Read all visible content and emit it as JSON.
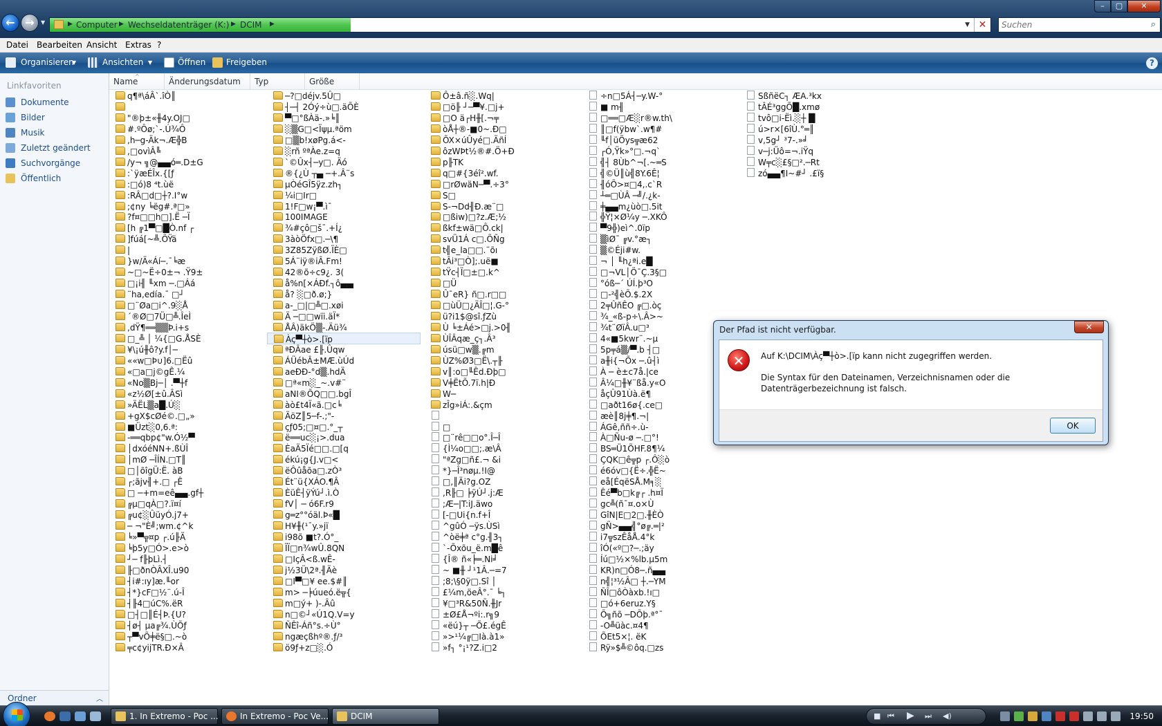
{
  "window": {
    "address": {
      "crumbs": [
        "Computer",
        "Wechseldatenträger (K:)",
        "DCIM"
      ],
      "progress_percent": 32
    },
    "search": {
      "placeholder": "Suchen"
    }
  },
  "menu": [
    "Datei",
    "Bearbeiten",
    "Ansicht",
    "Extras",
    "?"
  ],
  "toolbar": {
    "organize": "Organisieren",
    "views": "Ansichten",
    "open": "Öffnen",
    "share": "Freigeben"
  },
  "sidebar": {
    "title": "Linkfavoriten",
    "items": [
      "Dokumente",
      "Bilder",
      "Musik",
      "Zuletzt geändert",
      "Suchvorgänge",
      "Öffentlich"
    ],
    "folders": "Ordner"
  },
  "columns": [
    "Name",
    "Änderungsdatum",
    "Typ",
    "Größe"
  ],
  "files": [
    [
      {
        "t": "f",
        "n": "q¶ª\\áÂ`.îÒ║"
      },
      {
        "t": "f",
        "n": ""
      },
      {
        "t": "f",
        "n": "\"®þ±«╫4y.OJ□"
      },
      {
        "t": "f",
        "n": "#.ºÔø;`-.Ú¾Ô"
      },
      {
        "t": "f",
        "n": ",h─g-Äk¬.Æ╬B"
      },
      {
        "t": "f",
        "n": ",□ovìÂ╚"
      },
      {
        "t": "f",
        "n": "/y¬ ╗@▄▄ó═.D±G"
      },
      {
        "t": "f",
        "n": ":`ÿæÉÎx.{[ƒ"
      },
      {
        "t": "f",
        "n": ":□ó)8 ⁴t.ùë"
      },
      {
        "t": "f",
        "n": ":RÂ□d□┼?.I°w"
      },
      {
        "t": "f",
        "n": ";¢ny ╘ëg#.ª□»"
      },
      {
        "t": "f",
        "n": "?f¤□□h□].Ë ─Ï"
      },
      {
        "t": "f",
        "n": "[h ╔1▀□█Ò.nf ┌"
      },
      {
        "t": "f",
        "n": "]fúá[~╩.ÕŸä"
      },
      {
        "t": "f",
        "n": "|"
      },
      {
        "t": "f",
        "n": "}w/Ä«Áí─.¯╘æ"
      },
      {
        "t": "f",
        "n": "~□~Ë÷0±¬ .Ÿ9±"
      },
      {
        "t": "f",
        "n": "□¡i╢ ╙xm ─.□Áá"
      },
      {
        "t": "f",
        "n": "¨ha,edía.¯ □┘"
      },
      {
        "t": "f",
        "n": "□¨Øa□i^.9░Å"
      },
      {
        "t": "f",
        "n": "´®Ø□7Ü□╩.ÎeÌ"
      },
      {
        "t": "f",
        "n": ",dŸ¶══▒▒Þ.i+s"
      },
      {
        "t": "f",
        "n": "□_╩ │ ¼{□G.ÅSÈ"
      },
      {
        "t": "f",
        "n": "¥\\¡ú╫ô?y.f│─"
      },
      {
        "t": "f",
        "n": "««w□Þ∪]6.□Ëû"
      },
      {
        "t": "f",
        "n": "«□a□j©gÊ.¼"
      },
      {
        "t": "f",
        "n": "«No▒Bj─│ .▀┼f"
      },
      {
        "t": "f",
        "n": "«z½Ø[±û.ÂSì"
      },
      {
        "t": "f",
        "n": "»ÄËL▒a█.Ú░"
      },
      {
        "t": "f",
        "n": "+gX$cØé©.□„»"
      },
      {
        "t": "f",
        "n": "■Üzt░0,6.ª:"
      },
      {
        "t": "f",
        "n": "-══qbp¢\"w.Ó½▀"
      },
      {
        "t": "f",
        "n": "│dxóéNN+.ßÙÎ"
      },
      {
        "t": "f",
        "n": "│mØ ─ÎÍN.□T║"
      },
      {
        "t": "f",
        "n": "□│õîgÜ:Ë. àB"
      },
      {
        "t": "f",
        "n": "┌;ãjv╢+.□ ┌Ê"
      },
      {
        "t": "f",
        "n": "□ ─+m=eê▄▄.gf┼"
      },
      {
        "t": "f",
        "n": "╔µ□qÀ□?.ï¤í"
      },
      {
        "t": "f",
        "n": "╔u¢░ÛüyÓ.j7+"
      },
      {
        "t": "f",
        "n": "─ ¬\"È╝;wm.¢^k"
      },
      {
        "t": "f",
        "n": "╘»▀╦¤p ┌.ú╟Ä"
      },
      {
        "t": "f",
        "n": "╘þ5y□Ó>.e>ò"
      },
      {
        "t": "f",
        "n": "┘─ f╟þLì.┤"
      },
      {
        "t": "f",
        "n": "╟□ðnÒÂXÎ.u90"
      },
      {
        "t": "f",
        "n": "┤i#:ıy]æ.╙or"
      },
      {
        "t": "f",
        "n": "┤*}cF□½¨.ú-Î"
      },
      {
        "t": "f",
        "n": "┤╟4□úC%.ëR"
      },
      {
        "t": "f",
        "n": "□┤□║É┤Þ.{U?"
      },
      {
        "t": "f",
        "n": "┤ø┤ µa╔¾.ÙÕƒ"
      },
      {
        "t": "f",
        "n": "┬▀vÕ╪ë§□.~ò"
      },
      {
        "t": "f",
        "n": "╤c¢yijTR.Ð×Â"
      }
    ],
    [
      {
        "t": "f",
        "n": "─?□déjv.5Û□"
      },
      {
        "t": "f",
        "n": "┤─┤ 2Óý÷ù□.äÕÈ"
      },
      {
        "t": "f",
        "n": "▀□°ßÀä-.»╘║"
      },
      {
        "t": "f",
        "n": "░▒G□<Ïψµ.ªöm"
      },
      {
        "t": "f",
        "n": "□▒b!xøPg.á<-"
      },
      {
        "t": "f",
        "n": "░rñ ºªÀe.z=q"
      },
      {
        "t": "f",
        "n": "`©Ûx┤─y□. Äó"
      },
      {
        "t": "f",
        "n": "®{¿Ù ┬▄ ─+.Â¨s"
      },
      {
        "t": "f",
        "n": "µÒéGÎ5ÿz.zh┐"
      },
      {
        "t": "f",
        "n": "¼i□Ir□"
      },
      {
        "t": "f",
        "n": "1!F□w¡▀.ì¯"
      },
      {
        "t": "f",
        "n": "100IMAGE"
      },
      {
        "t": "f",
        "n": "¾#çô□š¯.+Í¿"
      },
      {
        "t": "f",
        "n": "3àòÖfx□.─\\¶"
      },
      {
        "t": "f",
        "n": "3Z85ZÿßØ.ÏÈ□"
      },
      {
        "t": "f",
        "n": "5Á¨iÿ®iÂ.Fm!"
      },
      {
        "t": "f",
        "n": "42®õ÷c9¿. 3("
      },
      {
        "t": "f",
        "n": "å%n[×ÁÐf.┐ô▄▄"
      },
      {
        "t": "f",
        "n": "å? ░□ð.ø;}"
      },
      {
        "t": "f",
        "n": "a-_□|□╩□.xøi"
      },
      {
        "t": "f",
        "n": "Ä ─□□wïi.äÏ*"
      },
      {
        "t": "f",
        "n": "ÅÂ)äkÖ▒-.Äü¾"
      },
      {
        "t": "f",
        "n": "Àç▀┼ò>.[ïp",
        "sel": true
      },
      {
        "t": "f",
        "n": "ªÐÂae £╟.Ûqw"
      },
      {
        "t": "f",
        "n": "ÁÜébÂ±MÆ.ùÚd"
      },
      {
        "t": "f",
        "n": "aeÐÐ-°d▒.hdÄ"
      },
      {
        "t": "f",
        "n": "□ª«m░_~.v#¨"
      },
      {
        "t": "f",
        "n": "aNI®ÕQ□□.bgÎ"
      },
      {
        "t": "f",
        "n": "àò£t4Ï«ã.□c╘"
      },
      {
        "t": "f",
        "n": "ÄöZ║5─f-.;\"-"
      },
      {
        "t": "f",
        "n": "çƒ05;□¤□.°_┬"
      },
      {
        "t": "f",
        "n": "ë══uc░¡>.dua"
      },
      {
        "t": "f",
        "n": "ÈaÄ5Ïé□□.□[q"
      },
      {
        "t": "f",
        "n": "ékú¡g{J.v□<"
      },
      {
        "t": "f",
        "n": "ëÔûåõa□.zÒ³"
      },
      {
        "t": "f",
        "n": "Ét¨ü{XÁO.¶Â"
      },
      {
        "t": "f",
        "n": "ÈüÊ┤ÿÝú┘.ì.Ò"
      },
      {
        "t": "f",
        "n": "fV│ ─ ó6F.r9"
      },
      {
        "t": "f",
        "n": "g═z°°óäl.Þ«█"
      },
      {
        "t": "f",
        "n": "H¥╫(¹¯y.»jï"
      },
      {
        "t": "f",
        "n": "i98õ ■t?.Ó°_"
      },
      {
        "t": "f",
        "n": "ÏÏ□n¾wÛ.8QN"
      },
      {
        "t": "f",
        "n": "□IçÂ<ß.wÊ-"
      },
      {
        "t": "f",
        "n": "j½3Ü\\2ª.╢Äè"
      },
      {
        "t": "f",
        "n": "□I▀□¥ ee.$#║"
      },
      {
        "t": "f",
        "n": "m> ─╞úueó.ë╦{"
      },
      {
        "t": "f",
        "n": "m□ý+ )-.Âû"
      },
      {
        "t": "f",
        "n": "n□©┘«Ú1Q.V=y"
      },
      {
        "t": "f",
        "n": "ÑÊî-Áñ°s.÷Ù°"
      },
      {
        "t": "f",
        "n": "ngæçßhº®.ƒ/³"
      },
      {
        "t": "f",
        "n": "ö9ƒ+z□░.Ó"
      }
    ],
    [
      {
        "t": "f",
        "n": "Ô±â.ñ░.Wq|"
      },
      {
        "t": "f",
        "n": "□ö╟ ┘─▀¥.□j+"
      },
      {
        "t": "f",
        "n": "□O ä┌H╫[.¬╤"
      },
      {
        "t": "f",
        "n": "òÅ┼®-■0~.Ð□"
      },
      {
        "t": "f",
        "n": "ÕX×úÛyé□.ÄñÍ"
      },
      {
        "t": "f",
        "n": "ôzWÞt½®#.Ö+Ð"
      },
      {
        "t": "f",
        "n": "p╟TK"
      },
      {
        "t": "f",
        "n": "q□#{3éî².wf."
      },
      {
        "t": "f",
        "n": "□rØwäN─▀.÷3°"
      },
      {
        "t": "f",
        "n": "S□"
      },
      {
        "t": "f",
        "n": "S-¬Dd╢Ð.æ¨□"
      },
      {
        "t": "f",
        "n": "□ßiw)□?z.Æ;½"
      },
      {
        "t": "f",
        "n": "ßkf±wä□Ô.ck|"
      },
      {
        "t": "f",
        "n": "svÜ1Á c□.ÕÑg"
      },
      {
        "t": "f",
        "n": "t╣e_la□□.¨õı"
      },
      {
        "t": "f",
        "n": "tÂi³□Ò];.uë■"
      },
      {
        "t": "f",
        "n": "tŸc┤Ï□±□.k^"
      },
      {
        "t": "f",
        "n": "□Ü"
      },
      {
        "t": "f",
        "n": "Û¯eR} ñ□.r□□"
      },
      {
        "t": "f",
        "n": "□ùÜ□¿ÄÎ□¦.G-°"
      },
      {
        "t": "f",
        "n": "ü?i1$@sî.ƒZù"
      },
      {
        "t": "f",
        "n": "Ù ╘±Áé>□j.>0╢"
      },
      {
        "t": "f",
        "n": "ÙÎÂqæ_ç┐.Â³"
      },
      {
        "t": "f",
        "n": "úsü□w▒.╔m"
      },
      {
        "t": "f",
        "n": "ÙZ%Ø3□Ë\\.┬╟"
      },
      {
        "t": "f",
        "n": "v║:o□╙Êd.Ðþ□"
      },
      {
        "t": "f",
        "n": "V╪ËtÕ.7ï.h|Ð"
      },
      {
        "t": "f",
        "n": "W─"
      },
      {
        "t": "f",
        "n": "zÎg»iÁ:.&çm"
      },
      {
        "t": "d",
        "n": ""
      },
      {
        "t": "d",
        "n": "□"
      },
      {
        "t": "d",
        "n": "□¨rê□□o°.Î─Î"
      },
      {
        "t": "d",
        "n": "{Ì¼o□□;.æ\\Â"
      },
      {
        "t": "d",
        "n": "\"ªZg□ñ£.¬ &i"
      },
      {
        "t": "d",
        "n": "*}─Î³nøµ.!I@"
      },
      {
        "t": "d",
        "n": "□,║Äi?g.OZ"
      },
      {
        "t": "d",
        "n": ",R╟□ ╞ÿÚ┘.j:Æ"
      },
      {
        "t": "d",
        "n": ";Æ─|T:iJ.äwo"
      },
      {
        "t": "d",
        "n": "[-□Ui{n.f+Î"
      },
      {
        "t": "d",
        "n": "^gûÓ ─ÿs.ÙSì"
      },
      {
        "t": "d",
        "n": "^òë╪ª c°g.╢3┐"
      },
      {
        "t": "d",
        "n": "`-Õxõu_ë.m█ê"
      },
      {
        "t": "d",
        "n": "{Î® ñ«╞═.Ni╛"
      },
      {
        "t": "d",
        "n": "~ ■╫ ┘¹1Â.─=7"
      },
      {
        "t": "d",
        "n": ";8;\\§0ÿ□.Sî │"
      },
      {
        "t": "d",
        "n": "£¼m,öeÂ°.¯ ╘┐"
      },
      {
        "t": "d",
        "n": "¥□³R&50Ñ.╫Jr"
      },
      {
        "t": "d",
        "n": "±Ø£Å¬ºi:.r╗9"
      },
      {
        "t": "d",
        "n": "«ëú}┬ ─Õ£.égÊ"
      },
      {
        "t": "d",
        "n": "»>¹¼╔□Ià.à1»"
      },
      {
        "t": "d",
        "n": "»f┐ °¡¹?Z.i□2"
      }
    ],
    [
      {
        "t": "d",
        "n": "÷n□5Á┤─y.W-°"
      },
      {
        "t": "d",
        "n": "■ m╢"
      },
      {
        "t": "d",
        "n": "□══□Æ░r®w.th\\"
      },
      {
        "t": "d",
        "n": "║□f(ÿbw`.w¶#"
      },
      {
        "t": "d",
        "n": "╙f│üÕys╦æ62"
      },
      {
        "t": "d",
        "n": "┌Ó,Ÿk»°□.¬q`"
      },
      {
        "t": "d",
        "n": "╣┤ 8Ùb^¬[.~═S"
      },
      {
        "t": "d",
        "n": "╣©Ü║ù╣8Y.6Ê¦"
      },
      {
        "t": "d",
        "n": "╢óÕ>¤□4,.c`R"
      },
      {
        "t": "d",
        "n": "┴═□ÙÂ ─╝/.¿k-"
      },
      {
        "t": "d",
        "n": "╪▄▄m¿ùò□.5it"
      },
      {
        "t": "d",
        "n": "╬Ÿ¦×Ø¼y ─.XKÔ"
      },
      {
        "t": "d",
        "n": "▀9╬)eì^.0ïp"
      },
      {
        "t": "d",
        "n": "▒ìØ¯ ╔v.°æ┐"
      },
      {
        "t": "d",
        "n": "▒©Éji#w."
      },
      {
        "t": "d",
        "n": "¬ │ ╙h¿ªi.e█"
      },
      {
        "t": "d",
        "n": "□¬VL│Ö¯Ç.3§□"
      },
      {
        "t": "d",
        "n": "°óß─´ ÚÍ.þ³O"
      },
      {
        "t": "d",
        "n": "□-²╣èÕ.$.2X"
      },
      {
        "t": "d",
        "n": "2╤ÛñÊO ╔□.òç"
      },
      {
        "t": "d",
        "n": "¾_«ß-p÷\\.Â>~"
      },
      {
        "t": "d",
        "n": "¾t¨ØïÂ.u□³"
      },
      {
        "t": "d",
        "n": "4«■5kwr¨.~µ"
      },
      {
        "t": "d",
        "n": "5p╤á▒/▀.b ┤□"
      },
      {
        "t": "d",
        "n": "a╫i{¬Õx ─.û┤ì"
      },
      {
        "t": "d",
        "n": "À ─ è±c7å.|ce"
      },
      {
        "t": "d",
        "n": "Â¼□╫¥¨ßå.y«O"
      },
      {
        "t": "d",
        "n": "åçÛ91Ùà.ë¶"
      },
      {
        "t": "d",
        "n": "□aðt16ø{.ce□"
      },
      {
        "t": "d",
        "n": "æè║8j╪¶.¬|"
      },
      {
        "t": "d",
        "n": "ÁGê,ññ÷.ù-"
      },
      {
        "t": "d",
        "n": "À□Ñu-ø ─.□°!"
      },
      {
        "t": "d",
        "n": "BS═Ü1ÕHF.8¶¼"
      },
      {
        "t": "d",
        "n": "ÇQK□ê╦p ┌.Ô░ò"
      },
      {
        "t": "d",
        "n": "é6óv□{Ë÷.╬Ë~"
      },
      {
        "t": "d",
        "n": "eå[ÉqëSÅ.M╕░"
      },
      {
        "t": "d",
        "n": "Êé▀b□k╔┌ .h¤Ï"
      },
      {
        "t": "d",
        "n": "gc╩(ñ¯¤.o×Ù"
      },
      {
        "t": "d",
        "n": "GîN|E□2□.╫ÈÒ"
      },
      {
        "t": "d",
        "n": "gÑ>▄▄╣°ø╔.═|²"
      },
      {
        "t": "d",
        "n": "i7╦szÊåÅ.4°k"
      },
      {
        "t": "d",
        "n": "îÓ(«º□?─.;äy"
      },
      {
        "t": "d",
        "n": "Íú□½×%lb.µ5m"
      },
      {
        "t": "d",
        "n": "KR)n□Ó8─.ñ▄▄"
      },
      {
        "t": "d",
        "n": "n╣¦³½Â□ ┼.─YM"
      },
      {
        "t": "d",
        "n": "ÑÎ□ôÒàxb.!ı□"
      },
      {
        "t": "d",
        "n": "□ó+6eruz.Y§"
      },
      {
        "t": "d",
        "n": "Õ╗ñõ ─DÕþ.ª°¯"
      },
      {
        "t": "d",
        "n": "-O╩üàc.¤4¶"
      },
      {
        "t": "d",
        "n": "ÕEt5×¦. ëK"
      },
      {
        "t": "d",
        "n": "Rÿ»$╩©ôq.□zs"
      }
    ],
    [
      {
        "t": "d",
        "n": "SßñëC┐ ÆA.³kx"
      },
      {
        "t": "d",
        "n": "tÂÉ³ggÕ█.xmø"
      },
      {
        "t": "d",
        "n": "tvô□i-Ëì.░┼ █"
      },
      {
        "t": "d",
        "n": "ú>r×[6îÙ.°═║"
      },
      {
        "t": "d",
        "n": "v,5g┘ ³7-.»╛"
      },
      {
        "t": "d",
        "n": "v─j:Üô=¬.iŸq"
      },
      {
        "t": "d",
        "n": "W╤c░£§□².─Rt"
      },
      {
        "t": "d",
        "n": "zó▄▄¶I~#┘ .£ï§"
      }
    ]
  ],
  "dialog": {
    "title": "Der Pfad ist nicht verfügbar.",
    "close": "✕",
    "message1": "Auf K:\\DCIM\\Àç▀┼ò>.[ïp kann nicht zugegriffen werden.",
    "message2": "Die Syntax für den Dateinamen, Verzeichnisnamen oder die Datenträgerbezeichnung ist falsch.",
    "ok": "OK"
  },
  "taskbar": {
    "tasks": [
      "1. In Extremo - Poc ...",
      "In Extremo - Poc Ve...",
      "DCIM"
    ],
    "clock": "19:50"
  }
}
